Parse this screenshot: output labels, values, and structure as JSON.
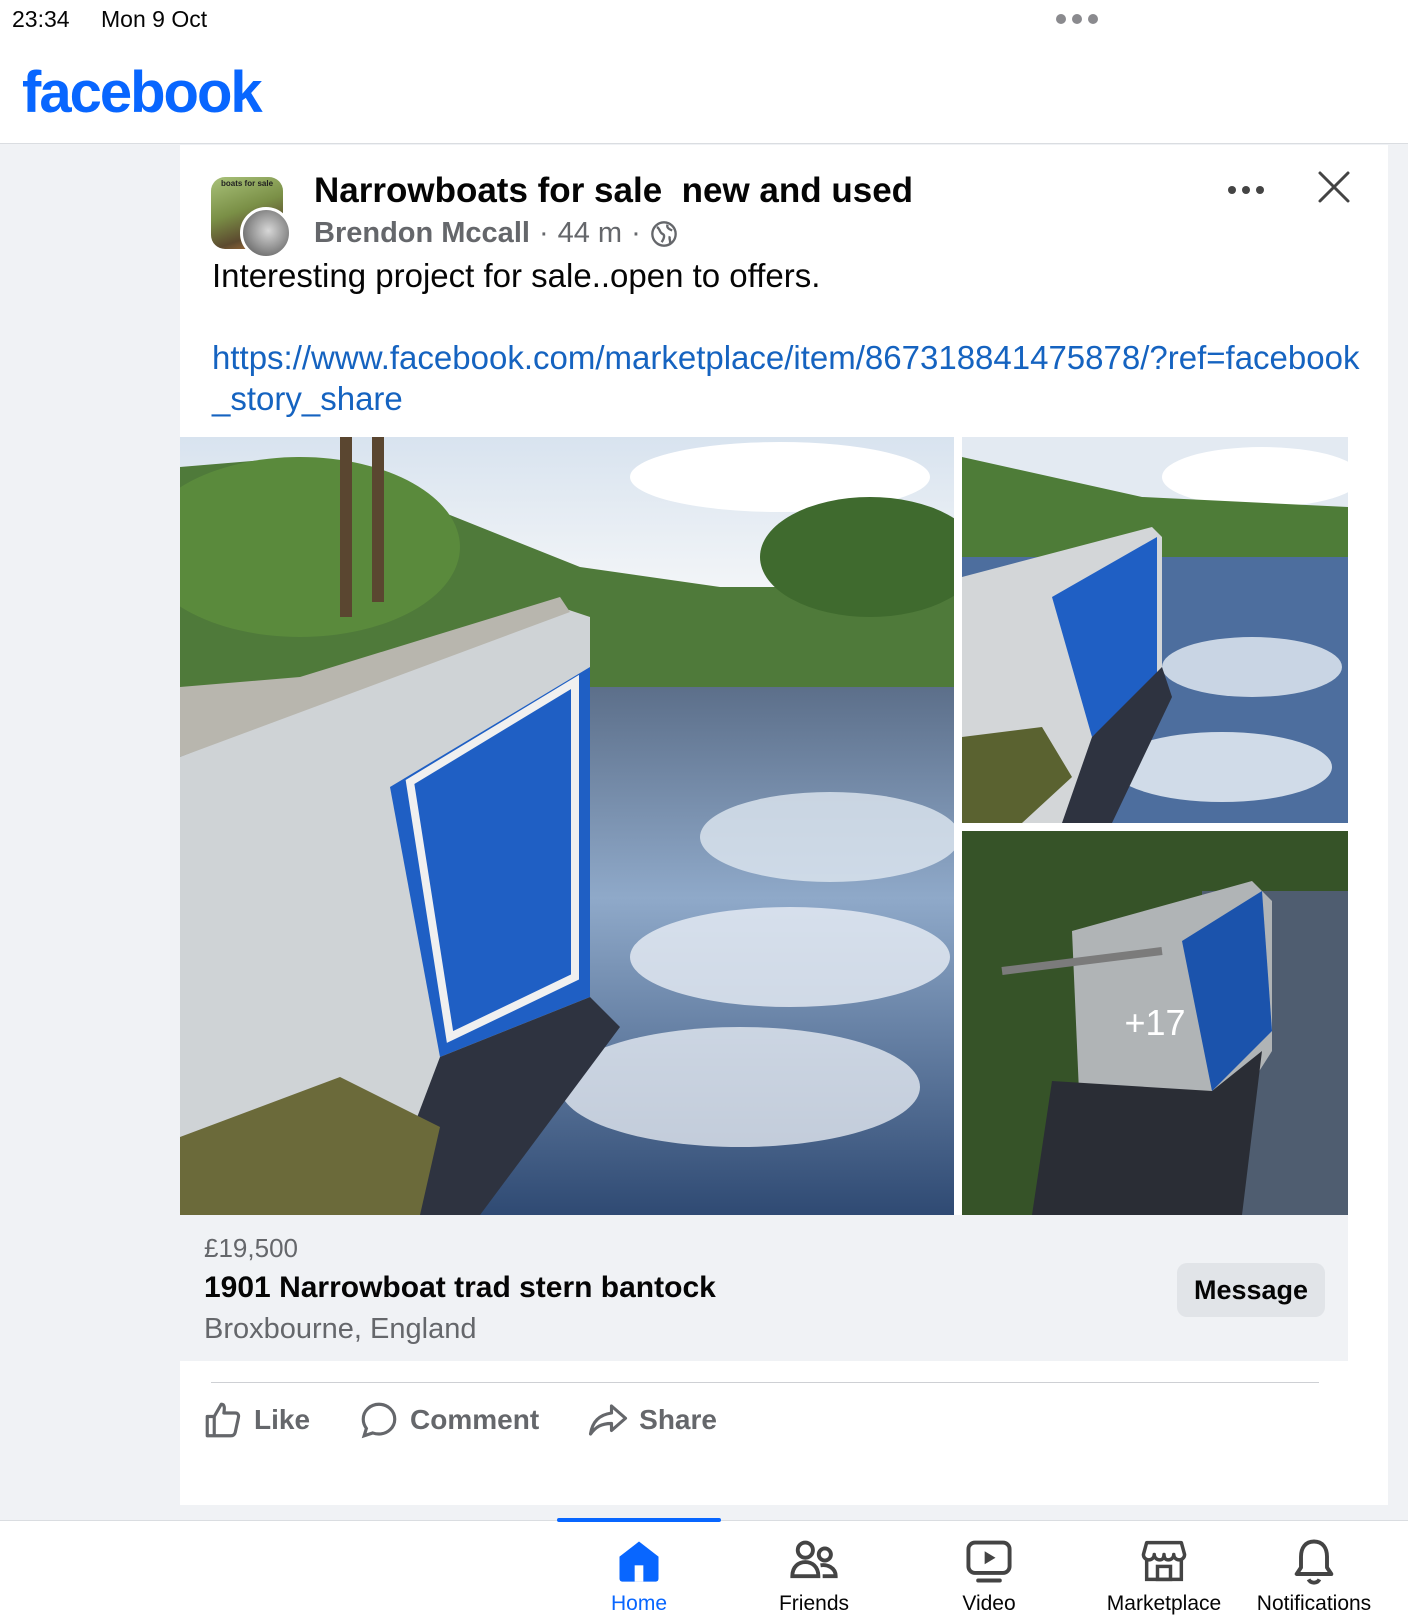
{
  "status_bar": {
    "time": "23:34",
    "date": "Mon 9 Oct"
  },
  "app": {
    "logo_text": "facebook",
    "brand_color": "#0866ff"
  },
  "post": {
    "group_name": "Narrowboats for sale  new and used",
    "group_avatar_label": "boats for sale",
    "author": "Brendon Mccall",
    "separator": "·",
    "time_ago": "44 m",
    "privacy_icon": "globe-icon",
    "text": "Interesting project for sale..open to offers.",
    "link": "https://www.facebook.com/marketplace/item/867318841475878/?ref=facebook_story_share",
    "more_photos_count": "+17",
    "listing": {
      "price": "£19,500",
      "title": "1901 Narrowboat trad stern bantock",
      "location": "Broxbourne, England",
      "message_label": "Message"
    },
    "actions": {
      "like": "Like",
      "comment": "Comment",
      "share": "Share"
    }
  },
  "tabs": [
    {
      "label": "Home",
      "icon": "home-icon",
      "active": true
    },
    {
      "label": "Friends",
      "icon": "friends-icon",
      "active": false
    },
    {
      "label": "Video",
      "icon": "video-icon",
      "active": false
    },
    {
      "label": "Marketplace",
      "icon": "marketplace-icon",
      "active": false
    },
    {
      "label": "Notifications",
      "icon": "bell-icon",
      "active": false
    }
  ]
}
